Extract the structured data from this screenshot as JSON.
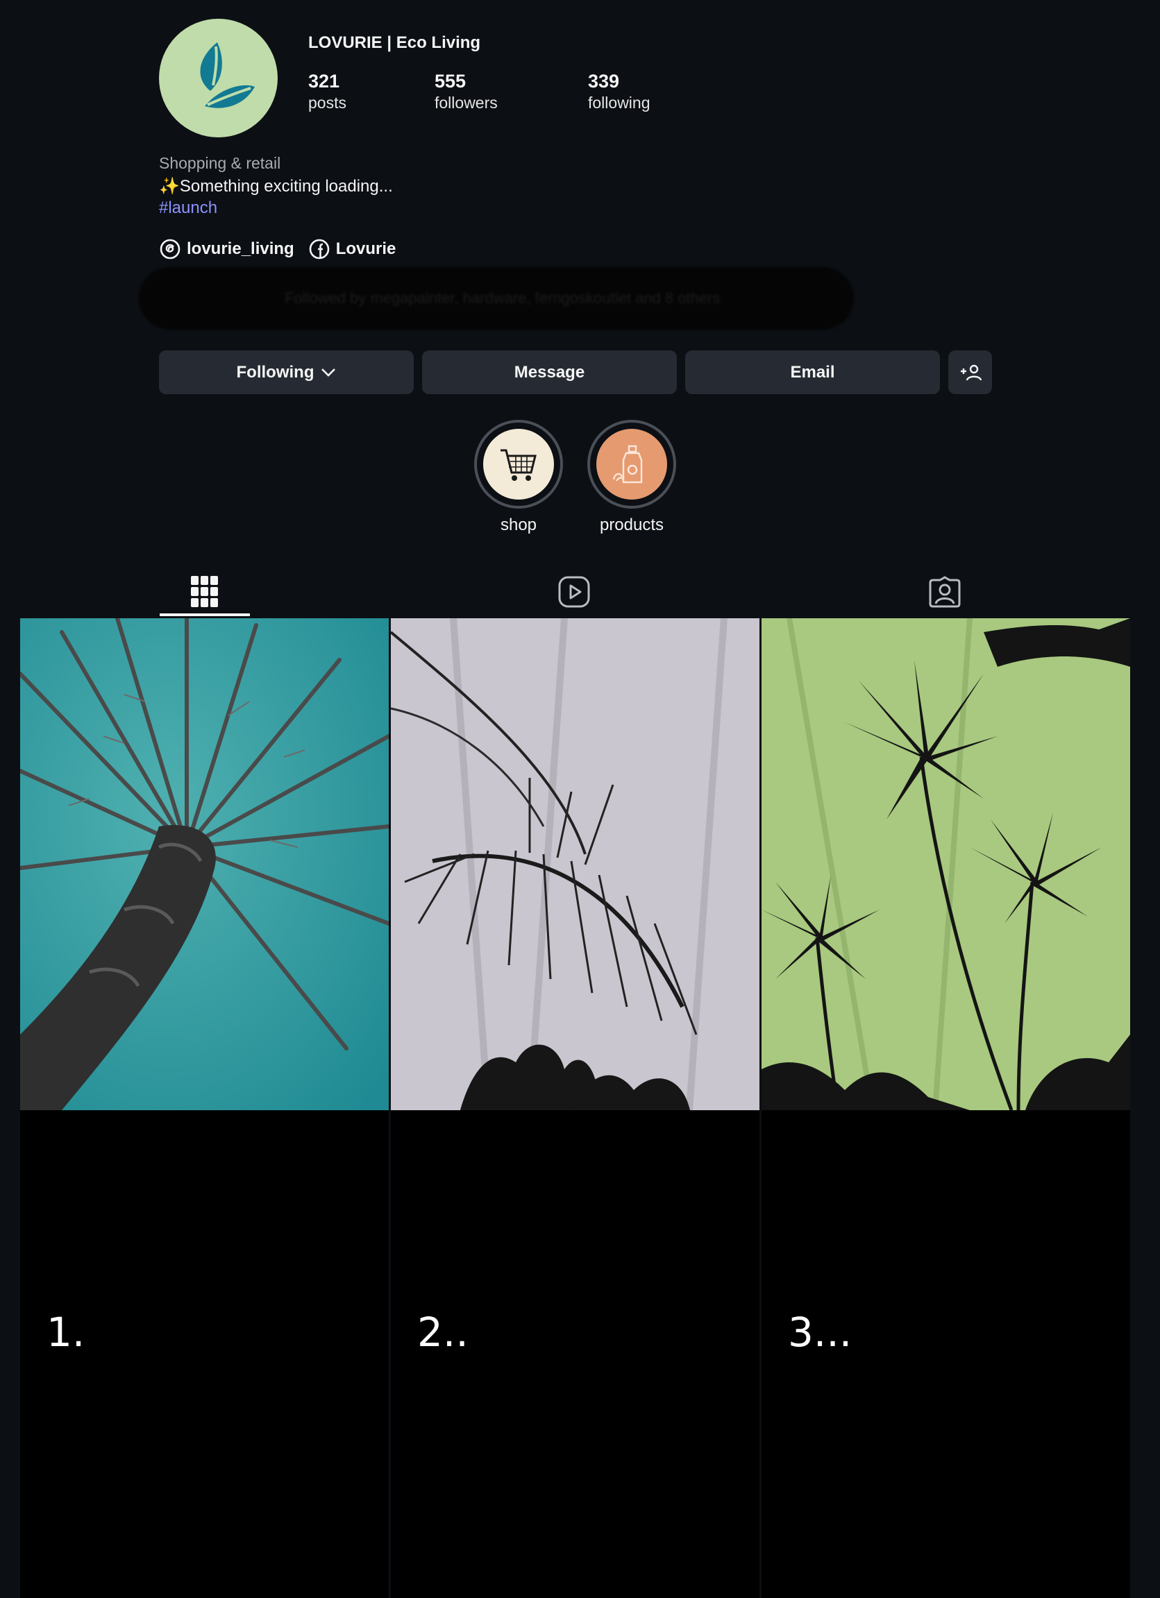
{
  "profile": {
    "username": "LOVURIE | Eco Living",
    "stats": [
      {
        "value": "321",
        "label": "posts"
      },
      {
        "value": "555",
        "label": "followers"
      },
      {
        "value": "339",
        "label": "following"
      }
    ],
    "category": "Shopping & retail",
    "bio": "✨Something exciting loading...",
    "hashtag": "#launch",
    "links": [
      {
        "icon": "threads-icon",
        "label": "lovurie_living"
      },
      {
        "icon": "facebook-icon",
        "label": "Lovurie"
      }
    ],
    "followed_by": "Followed by megapainter, hardware, ferngoskoutlet and 8 others"
  },
  "actions": {
    "following": "Following",
    "message": "Message",
    "email": "Email"
  },
  "highlights": [
    {
      "label": "shop",
      "icon": "cart-icon",
      "color": "#f4ead8"
    },
    {
      "label": "products",
      "icon": "bottle-icon",
      "color": "#e59a70"
    }
  ],
  "tabs": [
    "grid-icon",
    "reels-icon",
    "tagged-icon"
  ],
  "posts": [
    {
      "label": "1.",
      "bg": "#2a9b9c"
    },
    {
      "label": "2..",
      "bg": "#c9c6cf"
    },
    {
      "label": "3...",
      "bg": "#a8c97f"
    }
  ],
  "colors": {
    "background": "#0c0f14",
    "button": "#262b33",
    "accent": "#8c93ff"
  }
}
